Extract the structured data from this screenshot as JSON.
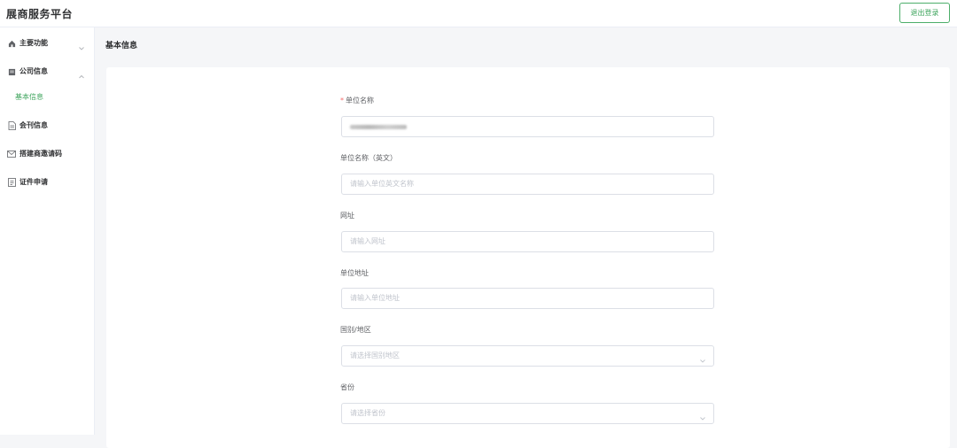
{
  "header": {
    "app_title": "展商服务平台",
    "logout_label": "退出登录"
  },
  "sidebar": {
    "items": [
      {
        "label": "主要功能",
        "icon": "home-icon",
        "expanded": false
      },
      {
        "label": "公司信息",
        "icon": "building-icon",
        "expanded": true,
        "children": [
          {
            "label": "基本信息",
            "active": true
          }
        ]
      },
      {
        "label": "会刊信息",
        "icon": "document-icon"
      },
      {
        "label": "搭建商邀请码",
        "icon": "mail-icon"
      },
      {
        "label": "证件申请",
        "icon": "file-icon"
      }
    ]
  },
  "main": {
    "page_title": "基本信息",
    "form": {
      "fields": [
        {
          "label": "单位名称",
          "required": true,
          "value": "",
          "placeholder": ""
        },
        {
          "label": "单位名称（英文）",
          "required": false,
          "placeholder": "请输入单位英文名称"
        },
        {
          "label": "网址",
          "required": false,
          "placeholder": "请输入网址"
        },
        {
          "label": "单位地址",
          "required": false,
          "placeholder": "请输入单位地址"
        },
        {
          "label": "国别/地区",
          "required": false,
          "placeholder": "请选择国别地区",
          "type": "select"
        },
        {
          "label": "省份",
          "required": false,
          "placeholder": "请选择省份",
          "type": "select"
        }
      ]
    }
  },
  "colors": {
    "accent": "#3fa55e",
    "required": "#f56c6c",
    "border": "#dcdfe6",
    "background": "#f5f6f8"
  }
}
